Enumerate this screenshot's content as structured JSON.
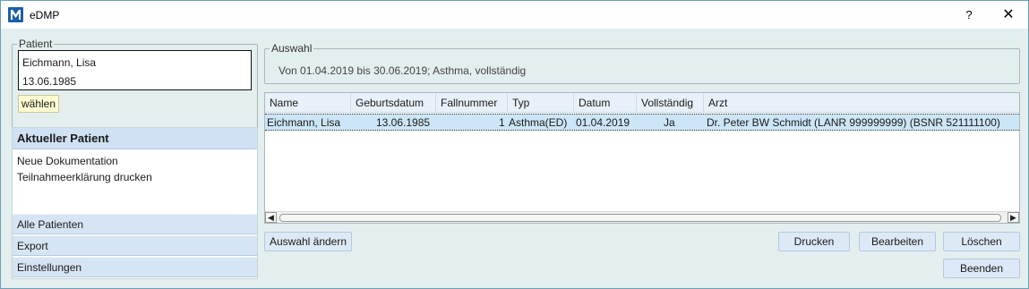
{
  "window": {
    "title": "eDMP",
    "help_label": "?",
    "close_label": "✕"
  },
  "patient": {
    "group_label": "Patient",
    "name": "Eichmann, Lisa",
    "birthdate": "13.06.1985",
    "select_button": "wählen"
  },
  "nav": {
    "header": "Aktueller Patient",
    "items": [
      "Neue Dokumentation",
      "Teilnahmeerklärung drucken"
    ],
    "sections": [
      "Alle Patienten",
      "Export",
      "Einstellungen"
    ]
  },
  "auswahl": {
    "group_label": "Auswahl",
    "text": "Von 01.04.2019 bis 30.06.2019; Asthma, vollständig"
  },
  "grid": {
    "columns": [
      "Name",
      "Geburtsdatum",
      "Fallnummer",
      "Typ",
      "Datum",
      "Vollständig",
      "Arzt"
    ],
    "rows": [
      {
        "name": "Eichmann, Lisa",
        "geburtsdatum": "13.06.1985",
        "fallnummer": "1",
        "typ": "Asthma(ED)",
        "datum": "01.04.2019",
        "vollstaendig": "Ja",
        "arzt": "Dr. Peter BW Schmidt (LANR 999999999) (BSNR 521111100)"
      }
    ],
    "scroll_left": "◀",
    "scroll_right": "▶"
  },
  "buttons": {
    "auswahl_aendern": "Auswahl ändern",
    "drucken": "Drucken",
    "bearbeiten": "Bearbeiten",
    "loeschen": "Löschen",
    "beenden": "Beenden"
  },
  "colors": {
    "accent": "#1b5fa8",
    "selected_row": "#cde6f7",
    "nav_header": "#cfe1f2",
    "button_bg": "#dce9f6",
    "select_button_bg": "#fdfbd0"
  }
}
